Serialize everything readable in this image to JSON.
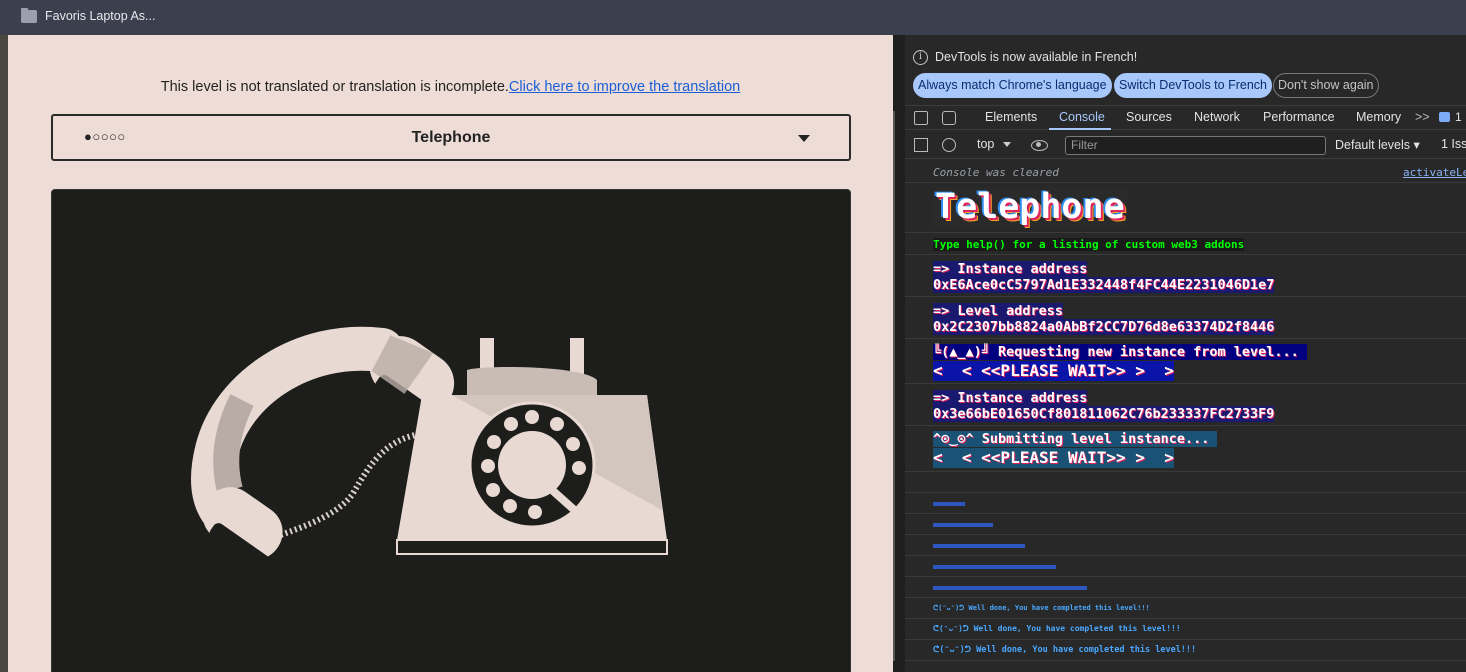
{
  "browser": {
    "title": "Favoris Laptop As..."
  },
  "page": {
    "notice_text": "This level is not translated or translation is incomplete.",
    "notice_link": "Click here to improve the translation",
    "selector": {
      "dots": "●○○○○",
      "level_name": "Telephone"
    }
  },
  "devtools": {
    "info_text": "DevTools is now available in French!",
    "buttons": {
      "match": "Always match Chrome's language",
      "switch": "Switch DevTools to French",
      "dismiss": "Don't show again"
    },
    "tabs": [
      "Elements",
      "Console",
      "Sources",
      "Network",
      "Performance",
      "Memory"
    ],
    "active_tab": "Console",
    "more_tabs": ">>",
    "badge_count": "1",
    "toolbar": {
      "context": "top",
      "filter_placeholder": "Filter",
      "levels": "Default levels ▾",
      "issues": "1 Iss"
    },
    "console": {
      "cleared": "Console was cleared",
      "source_link": "activateLe",
      "title": "Telephone",
      "help": "Type help() for a listing of custom web3 addons",
      "instance_label_1": "=> Instance address",
      "instance_address_1": "0xE6Ace0cC5797Ad1E332448f4FC44E2231046D1e7",
      "level_label": "=> Level address",
      "level_address": "0x2C2307bb8824a0AbBf2CC7D76d8e63374D2f8446",
      "requesting": "╚(▲_▲)╝ Requesting new instance from level...",
      "please_wait_1": "<  < <<PLEASE WAIT>> >  >",
      "instance_label_2": "=> Instance address",
      "instance_address_2": "0x3e66bE01650Cf801811062C76b233337FC2733F9",
      "submitting": "^⊙‿⊙^ Submitting level instance...",
      "please_wait_2": "<  < <<PLEASE WAIT>> >  >",
      "done_1": "ᕦ(ᵔᴗᵔ)ᕤ Well done, You have completed this level!!!",
      "done_2": "ᕦ(ᵔᴗᵔ)ᕤ Well done, You have completed this level!!!",
      "done_3": "ᕦ(ᵔᴗᵔ)ᕤ Well done, You have completed this level!!!"
    }
  },
  "colors": {
    "page_bg": "#eeddd6",
    "image_bg": "#1d1d1b",
    "link": "#1a5fd8",
    "devtools_bg": "#282828",
    "accent": "#a8c7fa"
  }
}
